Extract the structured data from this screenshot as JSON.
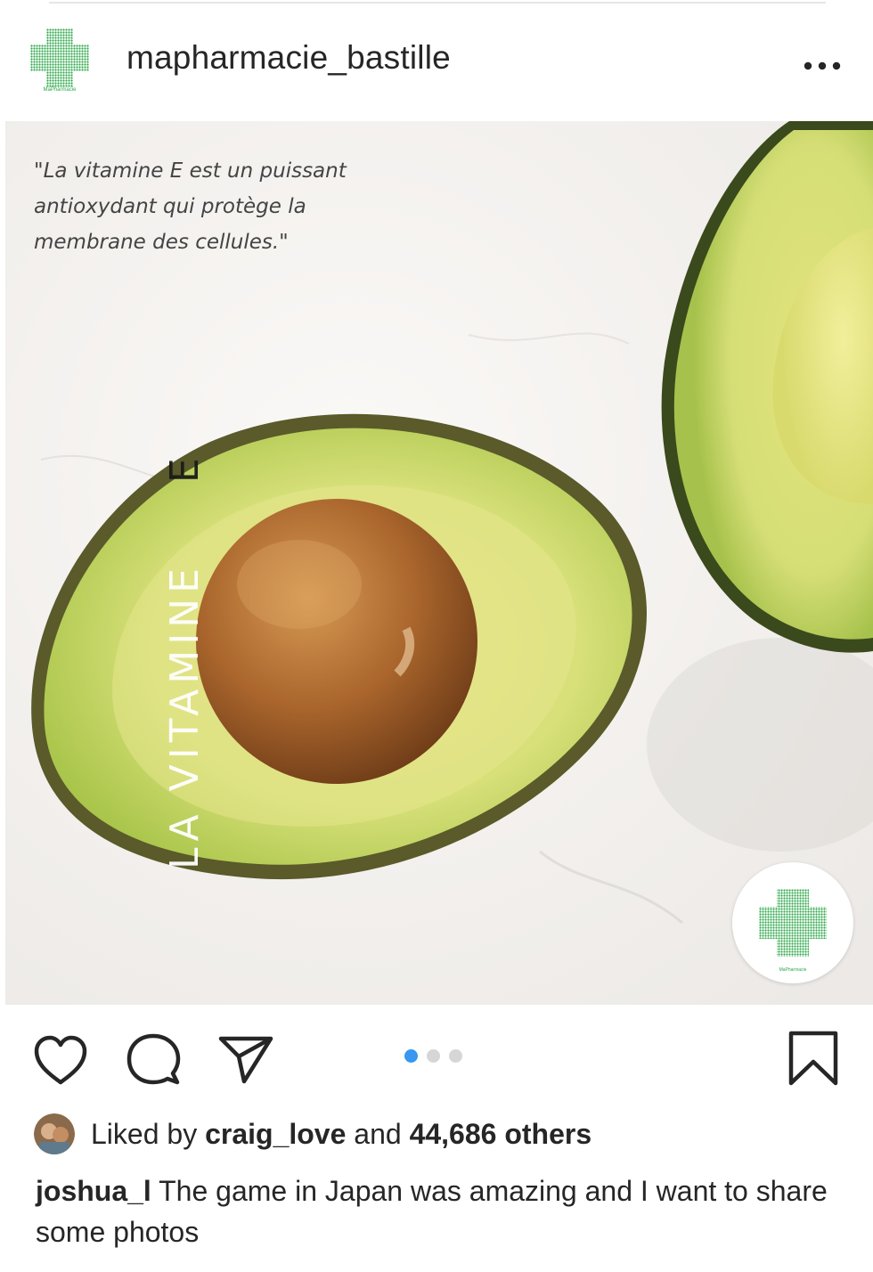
{
  "post": {
    "username": "mapharmacie_bastille",
    "avatar_brand_text": "MaPharmacie",
    "image": {
      "quote": "\"La vitamine E est un puissant antioxydant qui protège la membrane des cellules.\"",
      "vertical_title": "LA VITAMINE",
      "vertical_title_letter": "E",
      "badge_brand_text": "MaPharmacie"
    },
    "carousel": {
      "count": 3,
      "active_index": 0
    },
    "likes": {
      "prefix": "Liked by",
      "liker": "craig_love",
      "joiner": "and",
      "others": "44,686 others"
    },
    "caption": {
      "author": "joshua_l",
      "text": "The game in Japan was amazing and I want to share some photos"
    }
  },
  "icons": {
    "more": "more-horizontal-icon",
    "like": "heart-icon",
    "comment": "comment-bubble-icon",
    "share": "paper-plane-icon",
    "save": "bookmark-icon"
  },
  "colors": {
    "brand_green": "#2da84a",
    "accent_blue": "#3897f0",
    "text": "#262626"
  }
}
